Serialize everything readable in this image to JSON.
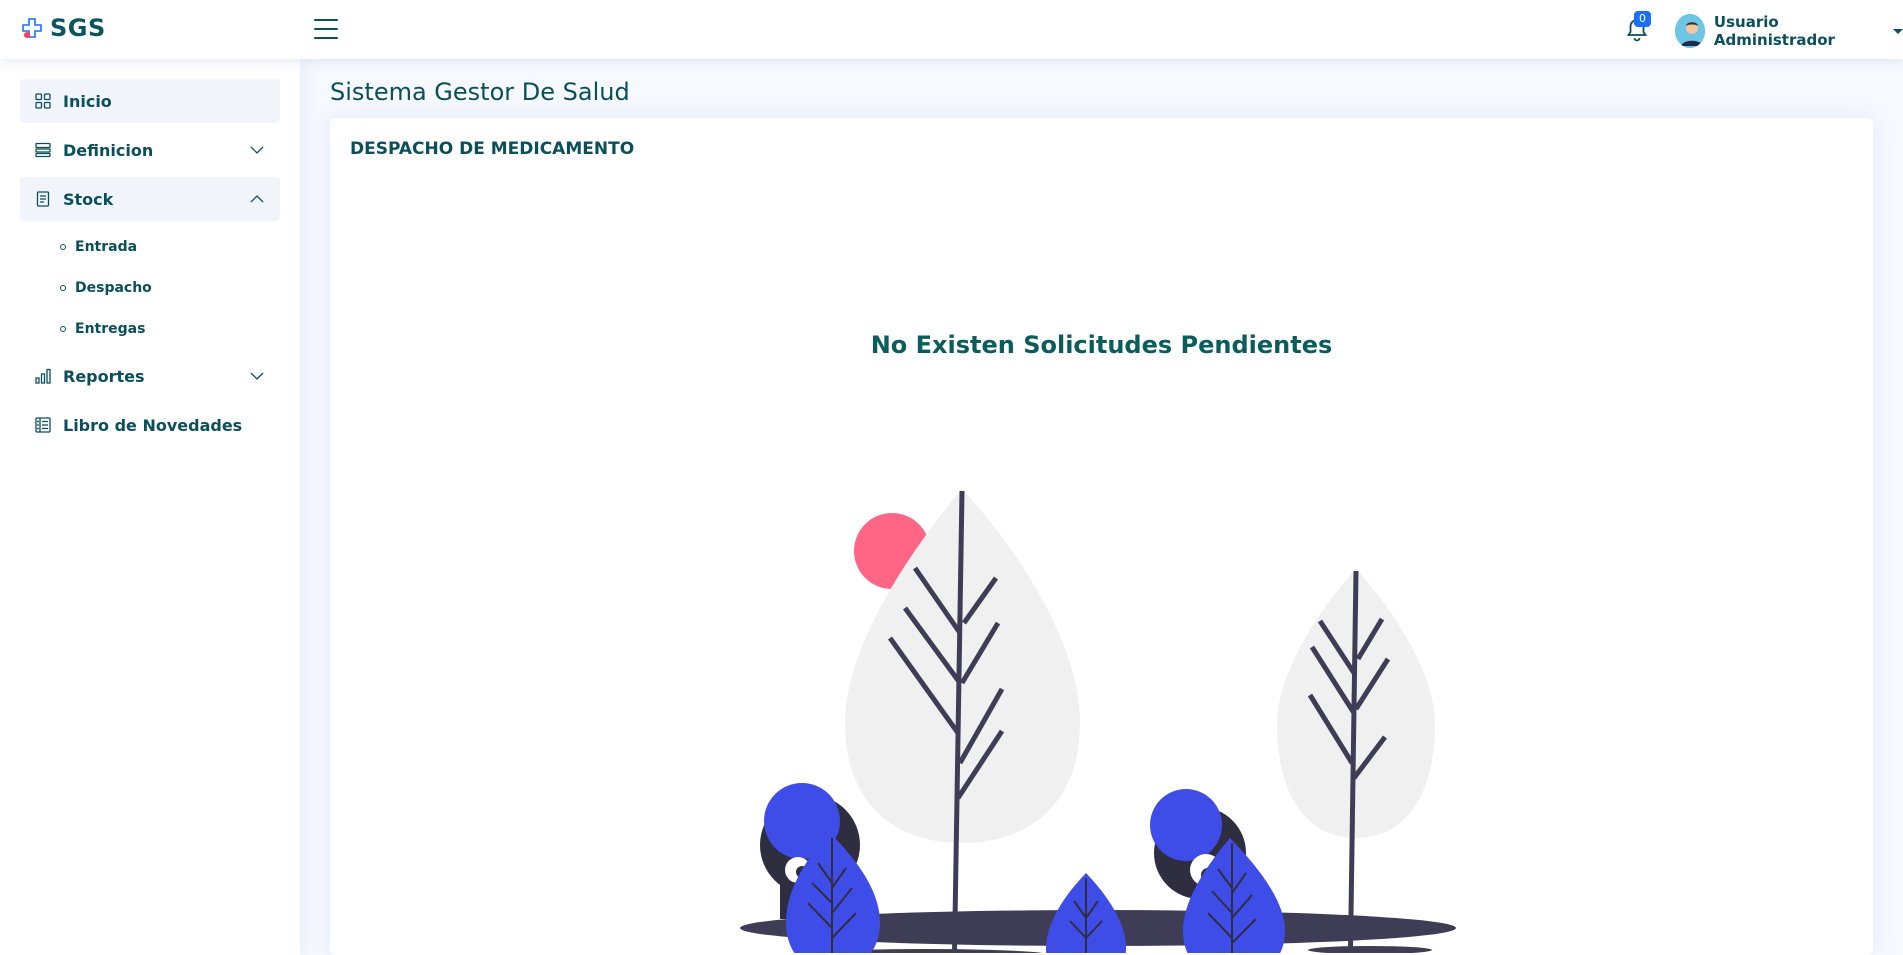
{
  "header": {
    "logo_text": "SGS",
    "notifications_count": "0",
    "user_name": "Usuario Administrador"
  },
  "sidebar": {
    "items": [
      {
        "label": "Inicio",
        "icon": "grid-icon",
        "active": true
      },
      {
        "label": "Definicion",
        "icon": "layers-icon",
        "expanded": false
      },
      {
        "label": "Stock",
        "icon": "journal-icon",
        "expanded": true,
        "children": [
          {
            "label": "Entrada"
          },
          {
            "label": "Despacho"
          },
          {
            "label": "Entregas"
          }
        ]
      },
      {
        "label": "Reportes",
        "icon": "bar-chart-icon",
        "expanded": false
      },
      {
        "label": "Libro de Novedades",
        "icon": "layout-text-icon"
      }
    ]
  },
  "main": {
    "page_title": "Sistema Gestor De Salud",
    "card_title": "DESPACHO DE MEDICAMENTO",
    "empty_message": "No Existen Solicitudes Pendientes"
  },
  "colors": {
    "primary_text": "#0b4f5c",
    "accent_blue": "#3f4de8",
    "accent_pink": "#ff6584",
    "dark": "#3f3d56",
    "leaf_gray": "#f0f0f0",
    "badge": "#1a6fff"
  }
}
